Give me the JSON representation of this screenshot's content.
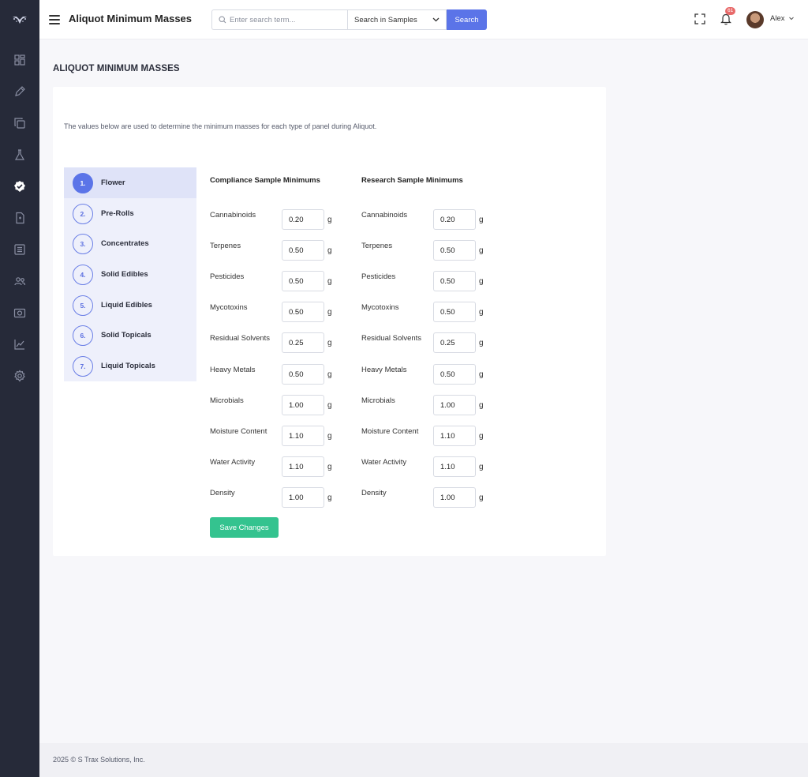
{
  "header": {
    "title": "Aliquot Minimum Masses",
    "search_placeholder": "Enter search term...",
    "search_scope": "Search in Samples",
    "search_button": "Search",
    "notification_count": "61",
    "user_name": "Alex"
  },
  "sidebar": {
    "items": [
      "dashboard-icon",
      "pencil-icon",
      "copy-icon",
      "flask-icon",
      "check-badge-icon",
      "file-icon",
      "list-icon",
      "users-icon",
      "camera-icon",
      "chart-icon",
      "gear-icon"
    ],
    "active_index": 4
  },
  "page": {
    "title": "ALIQUOT MINIMUM MASSES",
    "description": "The values below are used to determine the minimum masses for each type of panel during Aliquot."
  },
  "steps": [
    {
      "num": "1.",
      "label": "Flower"
    },
    {
      "num": "2.",
      "label": "Pre-Rolls"
    },
    {
      "num": "3.",
      "label": "Concentrates"
    },
    {
      "num": "4.",
      "label": "Solid Edibles"
    },
    {
      "num": "5.",
      "label": "Liquid Edibles"
    },
    {
      "num": "6.",
      "label": "Solid Topicals"
    },
    {
      "num": "7.",
      "label": "Liquid Topicals"
    }
  ],
  "active_step": 0,
  "compliance": {
    "heading": "Compliance Sample Minimums",
    "rows": [
      {
        "label": "Cannabinoids",
        "value": "0.20",
        "unit": "g"
      },
      {
        "label": "Terpenes",
        "value": "0.50",
        "unit": "g"
      },
      {
        "label": "Pesticides",
        "value": "0.50",
        "unit": "g"
      },
      {
        "label": "Mycotoxins",
        "value": "0.50",
        "unit": "g"
      },
      {
        "label": "Residual Solvents",
        "value": "0.25",
        "unit": "g"
      },
      {
        "label": "Heavy Metals",
        "value": "0.50",
        "unit": "g"
      },
      {
        "label": "Microbials",
        "value": "1.00",
        "unit": "g"
      },
      {
        "label": "Moisture Content",
        "value": "1.10",
        "unit": "g"
      },
      {
        "label": "Water Activity",
        "value": "1.10",
        "unit": "g"
      },
      {
        "label": "Density",
        "value": "1.00",
        "unit": "g"
      }
    ]
  },
  "research": {
    "heading": "Research Sample Minimums",
    "rows": [
      {
        "label": "Cannabinoids",
        "value": "0.20",
        "unit": "g"
      },
      {
        "label": "Terpenes",
        "value": "0.50",
        "unit": "g"
      },
      {
        "label": "Pesticides",
        "value": "0.50",
        "unit": "g"
      },
      {
        "label": "Mycotoxins",
        "value": "0.50",
        "unit": "g"
      },
      {
        "label": "Residual Solvents",
        "value": "0.25",
        "unit": "g"
      },
      {
        "label": "Heavy Metals",
        "value": "0.50",
        "unit": "g"
      },
      {
        "label": "Microbials",
        "value": "1.00",
        "unit": "g"
      },
      {
        "label": "Moisture Content",
        "value": "1.10",
        "unit": "g"
      },
      {
        "label": "Water Activity",
        "value": "1.10",
        "unit": "g"
      },
      {
        "label": "Density",
        "value": "1.00",
        "unit": "g"
      }
    ]
  },
  "save_button": "Save Changes",
  "footer": "2025 © S Trax Solutions, Inc."
}
